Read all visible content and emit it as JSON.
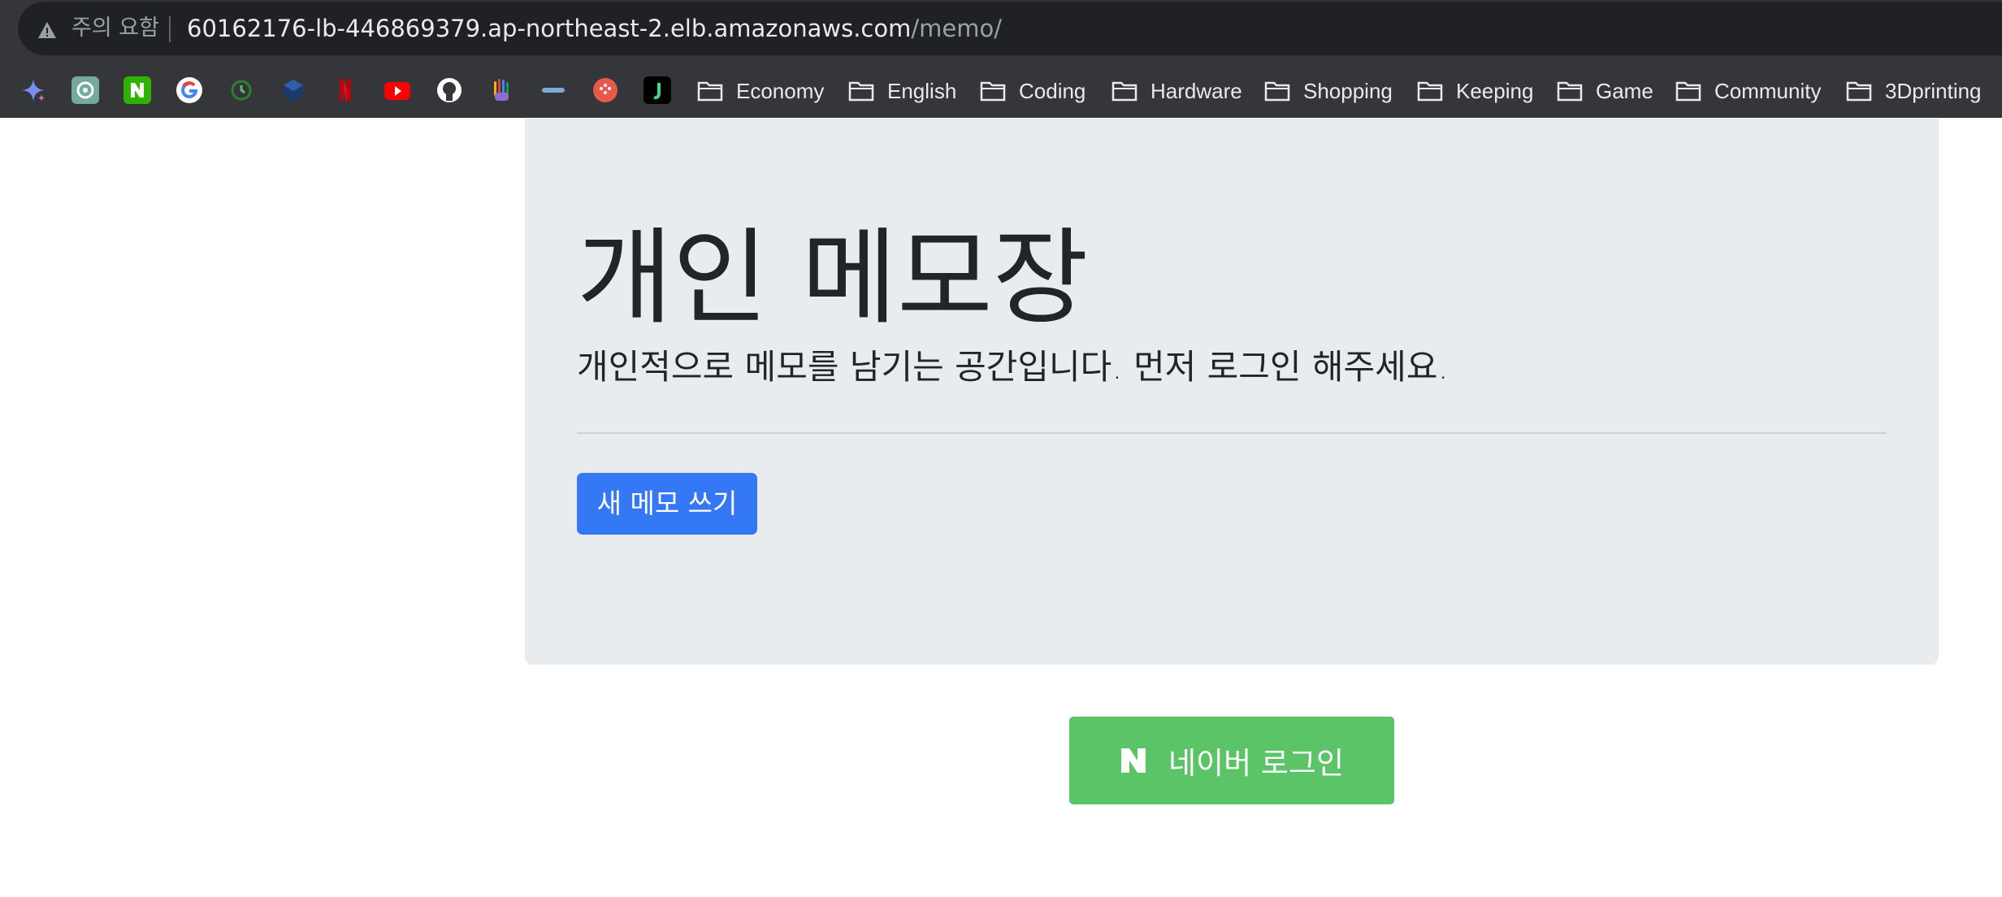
{
  "browser": {
    "security_warning": "주의 요함",
    "url_host": "60162176-lb-446869379.ap-northeast-2.elb.amazonaws.com",
    "url_path": "/memo/",
    "bookmark_icons": [
      "gemini-icon",
      "chatgpt-icon",
      "naver-icon",
      "google-icon",
      "clockify-icon",
      "cube-icon",
      "netflix-icon",
      "youtube-icon",
      "github-icon",
      "hand-icon",
      "mylemon-icon",
      "red-circle-icon",
      "jetbrains-icon"
    ],
    "bookmark_folders": [
      "Economy",
      "English",
      "Coding",
      "Hardware",
      "Shopping",
      "Keeping",
      "Game",
      "Community",
      "3Dprinting"
    ]
  },
  "page": {
    "title": "개인 메모장",
    "lead": "개인적으로 메모를 남기는 공간입니다. 먼저 로그인 해주세요.",
    "new_memo_button": "새 메모 쓰기",
    "naver_login_button": "네이버 로그인"
  },
  "colors": {
    "primary": "#3478f6",
    "naver_green": "#5ac466",
    "jumbotron_bg": "#e9ecef"
  }
}
